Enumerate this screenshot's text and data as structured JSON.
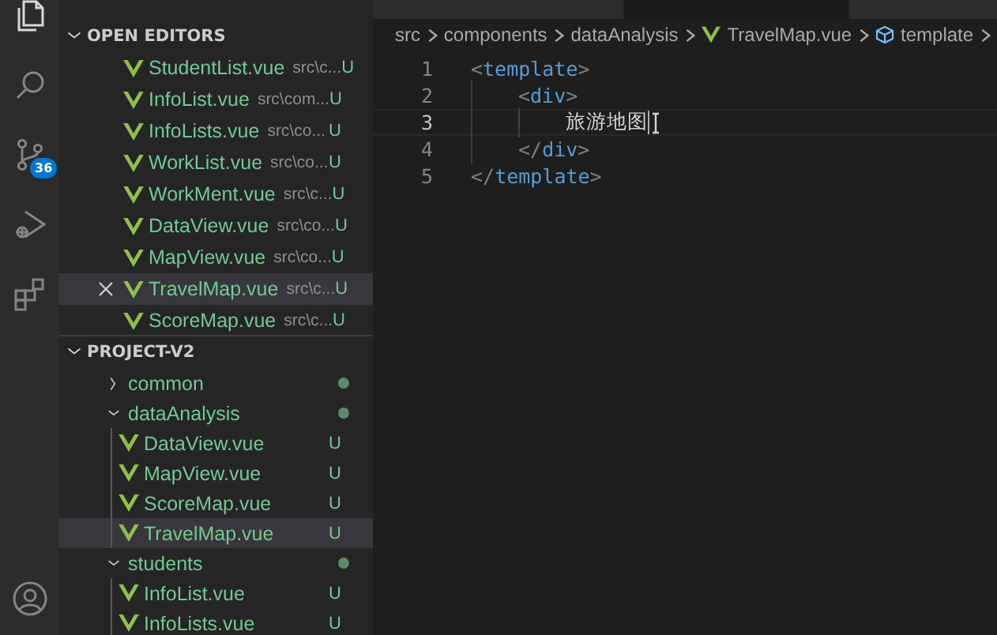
{
  "activity_bar": {
    "items": [
      {
        "kind": "explorer",
        "selected": true
      },
      {
        "kind": "search",
        "selected": false
      },
      {
        "kind": "source-control",
        "selected": false,
        "badge": "36"
      },
      {
        "kind": "run-debug",
        "selected": false
      },
      {
        "kind": "extensions",
        "selected": false
      }
    ],
    "bottom_items": [
      {
        "kind": "account",
        "selected": false
      }
    ]
  },
  "tabs": [
    {
      "selected": false
    },
    {
      "selected": true
    },
    {
      "selected": false
    }
  ],
  "open_editors": {
    "title": "OPEN EDITORS",
    "expanded": true,
    "items": [
      {
        "name": "StudentList.vue",
        "description": "src\\c...",
        "status": "U",
        "selected": false
      },
      {
        "name": "InfoList.vue",
        "description": "src\\com...",
        "status": "U",
        "selected": false
      },
      {
        "name": "InfoLists.vue",
        "description": "src\\co...",
        "status": "U",
        "selected": false
      },
      {
        "name": "WorkList.vue",
        "description": "src\\co...",
        "status": "U",
        "selected": false
      },
      {
        "name": "WorkMent.vue",
        "description": "src\\c...",
        "status": "U",
        "selected": false
      },
      {
        "name": "DataView.vue",
        "description": "src\\co...",
        "status": "U",
        "selected": false
      },
      {
        "name": "MapView.vue",
        "description": "src\\co...",
        "status": "U",
        "selected": false
      },
      {
        "name": "TravelMap.vue",
        "description": "src\\c...",
        "status": "U",
        "selected": true
      },
      {
        "name": "ScoreMap.vue",
        "description": "src\\c...",
        "status": "U",
        "selected": false
      }
    ]
  },
  "project": {
    "title": "PROJECT-V2",
    "expanded": true,
    "tree": [
      {
        "kind": "folder",
        "name": "common",
        "expanded": false,
        "has_changes": true,
        "selected": false
      },
      {
        "kind": "folder",
        "name": "dataAnalysis",
        "expanded": true,
        "has_changes": true,
        "selected": false,
        "children": [
          {
            "kind": "file",
            "name": "DataView.vue",
            "status": "U",
            "selected": false
          },
          {
            "kind": "file",
            "name": "MapView.vue",
            "status": "U",
            "selected": false
          },
          {
            "kind": "file",
            "name": "ScoreMap.vue",
            "status": "U",
            "selected": false
          },
          {
            "kind": "file",
            "name": "TravelMap.vue",
            "status": "U",
            "selected": true
          }
        ]
      },
      {
        "kind": "folder",
        "name": "students",
        "expanded": true,
        "has_changes": true,
        "selected": false,
        "children": [
          {
            "kind": "file",
            "name": "InfoList.vue",
            "status": "U",
            "selected": false
          },
          {
            "kind": "file",
            "name": "InfoLists.vue",
            "status": "U",
            "selected": false
          }
        ]
      }
    ]
  },
  "breadcrumbs": [
    {
      "kind": "folder",
      "text": "src"
    },
    {
      "kind": "folder",
      "text": "components"
    },
    {
      "kind": "folder",
      "text": "dataAnalysis"
    },
    {
      "kind": "vue-file",
      "text": "TravelMap.vue"
    },
    {
      "kind": "symbol",
      "text": "template"
    }
  ],
  "editor": {
    "lines": [
      {
        "number": "1",
        "current": false,
        "tokens": [
          {
            "kind": "punct",
            "text": "<"
          },
          {
            "kind": "tag",
            "text": "template"
          },
          {
            "kind": "punct",
            "text": ">"
          }
        ],
        "children": [
          {
            "number": "2",
            "current": false,
            "tokens": [
              {
                "kind": "punct",
                "text": "<"
              },
              {
                "kind": "tag",
                "text": "div"
              },
              {
                "kind": "punct",
                "text": ">"
              }
            ],
            "children": [
              {
                "number": "3",
                "current": true,
                "cursor": true,
                "tokens": [
                  {
                    "kind": "text",
                    "text": "旅游地图"
                  }
                ]
              }
            ]
          },
          {
            "number": "4",
            "current": false,
            "tokens": [
              {
                "kind": "punct",
                "text": "</"
              },
              {
                "kind": "tag",
                "text": "div"
              },
              {
                "kind": "punct",
                "text": ">"
              }
            ]
          }
        ]
      },
      {
        "number": "5",
        "current": false,
        "tokens": [
          {
            "kind": "punct",
            "text": "</"
          },
          {
            "kind": "tag",
            "text": "template"
          },
          {
            "kind": "punct",
            "text": ">"
          }
        ]
      }
    ]
  }
}
